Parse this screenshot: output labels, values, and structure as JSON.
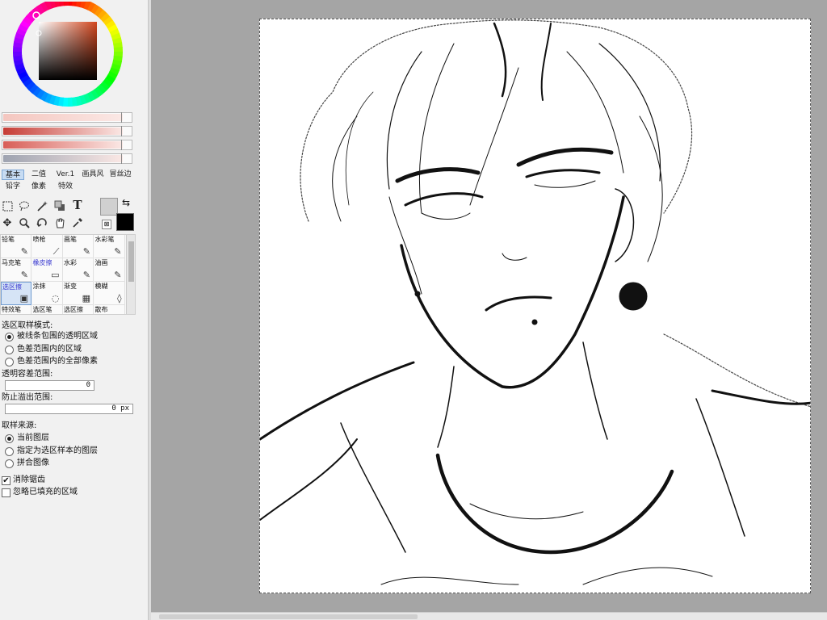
{
  "sliders": [
    {
      "name": "hue-slider",
      "color": "#f4c6bf"
    },
    {
      "name": "saturation-slider",
      "color": "#c63c35"
    },
    {
      "name": "value-slider",
      "color": "#d85e57"
    },
    {
      "name": "opacity-slider",
      "color": "#9ea3b0"
    }
  ],
  "color_tabs": [
    "基本",
    "二值",
    "Ver.1",
    "画具风",
    "冒丝边",
    "铅字",
    "像素",
    "特效"
  ],
  "colors": {
    "primary": "#d0d0d0",
    "secondary": "#000000"
  },
  "brushes": [
    {
      "label": "铅笔",
      "icon": "✎"
    },
    {
      "label": "喷枪",
      "icon": "⟋"
    },
    {
      "label": "画笔",
      "icon": "✎"
    },
    {
      "label": "水彩笔",
      "icon": "✎"
    },
    {
      "label": "马克笔",
      "icon": "✎"
    },
    {
      "label": "橡皮擦",
      "icon": "▭"
    },
    {
      "label": "水彩",
      "icon": "✎"
    },
    {
      "label": "油画",
      "icon": "✎"
    },
    {
      "label": "选区擦",
      "icon": "▣"
    },
    {
      "label": "涂抹",
      "icon": "◌"
    },
    {
      "label": "渐变",
      "icon": "▦"
    },
    {
      "label": "模糊",
      "icon": "◊"
    },
    {
      "label": "特效笔",
      "icon": ""
    },
    {
      "label": "选区笔",
      "icon": ""
    },
    {
      "label": "选区擦",
      "icon": ""
    },
    {
      "label": "散布",
      "icon": ""
    }
  ],
  "fill": {
    "mode_title": "选区取样模式:",
    "mode_options": [
      "被线条包围的透明区域",
      "色差范围内的区域",
      "色差范围内的全部像素"
    ],
    "tolerance_label": "透明容差范围:",
    "tolerance_value": "0",
    "overflow_label": "防止溢出范围:",
    "overflow_value": "0 px",
    "source_title": "取样来源:",
    "source_options": [
      "当前图层",
      "指定为选区样本的图层",
      "拼合图像"
    ],
    "antialias_label": "消除锯齿",
    "ignore_label": "忽略已填充的区域"
  }
}
